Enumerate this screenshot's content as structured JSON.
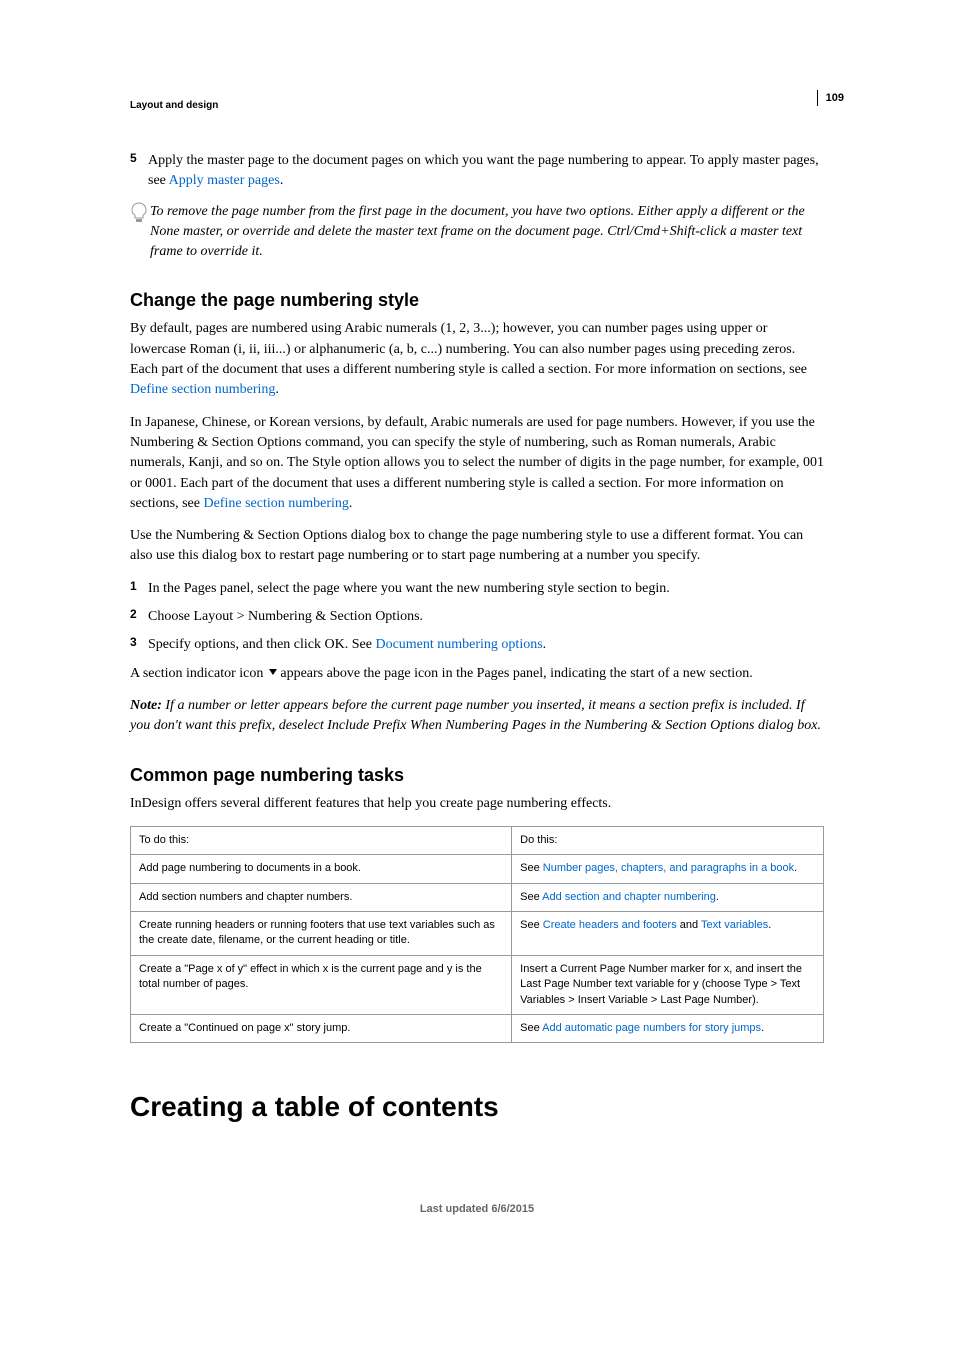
{
  "page_number": "109",
  "breadcrumb": "Layout and design",
  "step5": {
    "num": "5",
    "text_before": "Apply the master page to the document pages on which you want the page numbering to appear. To apply master pages, see ",
    "link": "Apply master pages",
    "text_after": "."
  },
  "tip": "To remove the page number from the first page in the document, you have two options. Either apply a different or the None master, or override and delete the master text frame on the document page. Ctrl/Cmd+Shift-click a master text frame to override it.",
  "sectionA": {
    "heading": "Change the page numbering style",
    "p1_before": "By default, pages are numbered using Arabic numerals (1, 2, 3...); however, you can number pages using upper or lowercase Roman (i, ii, iii...) or alphanumeric (a, b, c...) numbering. You can also number pages using preceding zeros. Each part of the document that uses a different numbering style is called a section. For more information on sections, see ",
    "p1_link": "Define section numbering",
    "p1_after": ".",
    "p2_before": "In Japanese, Chinese, or Korean versions, by default, Arabic numerals are used for page numbers. However, if you use the Numbering & Section Options command, you can specify the style of numbering, such as Roman numerals, Arabic numerals, Kanji, and so on. The Style option allows you to select the number of digits in the page number, for example, 001 or 0001. Each part of the document that uses a different numbering style is called a section. For more information on sections, see ",
    "p2_link": "Define section numbering",
    "p2_after": ".",
    "p3": "Use the Numbering & Section Options dialog box to change the page numbering style to use a different format. You can also use this dialog box to restart page numbering or to start page numbering at a number you specify.",
    "steps": [
      {
        "num": "1",
        "text": "In the Pages panel, select the page where you want the new numbering style section to begin."
      },
      {
        "num": "2",
        "text": "Choose Layout > Numbering & Section Options."
      },
      {
        "num": "3",
        "text_before": "Specify options, and then click OK. See ",
        "link": "Document numbering options",
        "text_after": "."
      }
    ],
    "indicator_before": "A section indicator icon ",
    "indicator_after": " appears above the page icon in the Pages panel, indicating the start of a new section.",
    "note_label": "Note: ",
    "note_text": "If a number or letter appears before the current page number you inserted, it means a section prefix is included. If you don't want this prefix, deselect Include Prefix When Numbering Pages in the Numbering & Section Options dialog box."
  },
  "sectionB": {
    "heading": "Common page numbering tasks",
    "intro": "InDesign offers several different features that help you create page numbering effects.",
    "table": {
      "header": [
        "To do this:",
        "Do this:"
      ],
      "rows": [
        {
          "left": "Add page numbering to documents in a book.",
          "right_before": "See ",
          "links": [
            "Number pages, chapters, and paragraphs in a book"
          ],
          "right_after": "."
        },
        {
          "left": "Add section numbers and chapter numbers.",
          "right_before": "See ",
          "links": [
            "Add section and chapter numbering"
          ],
          "right_after": "."
        },
        {
          "left": "Create running headers or running footers that use text variables such as the create date, filename, or the current heading or title.",
          "right_before": "See ",
          "links": [
            "Create headers and footers",
            "Text variables"
          ],
          "mid": " and ",
          "right_after": "."
        },
        {
          "left": "Create a \"Page x of y\" effect in which x is the current page and y is the total number of pages.",
          "right_plain": "Insert a Current Page Number marker for x, and insert the Last Page Number text variable for y (choose Type > Text Variables > Insert Variable > Last Page Number)."
        },
        {
          "left": "Create a \"Continued on page x\" story jump.",
          "right_before": "See ",
          "links": [
            "Add automatic page numbers for story jumps"
          ],
          "right_after": "."
        }
      ]
    }
  },
  "main_heading": "Creating a table of contents",
  "footer": "Last updated 6/6/2015"
}
